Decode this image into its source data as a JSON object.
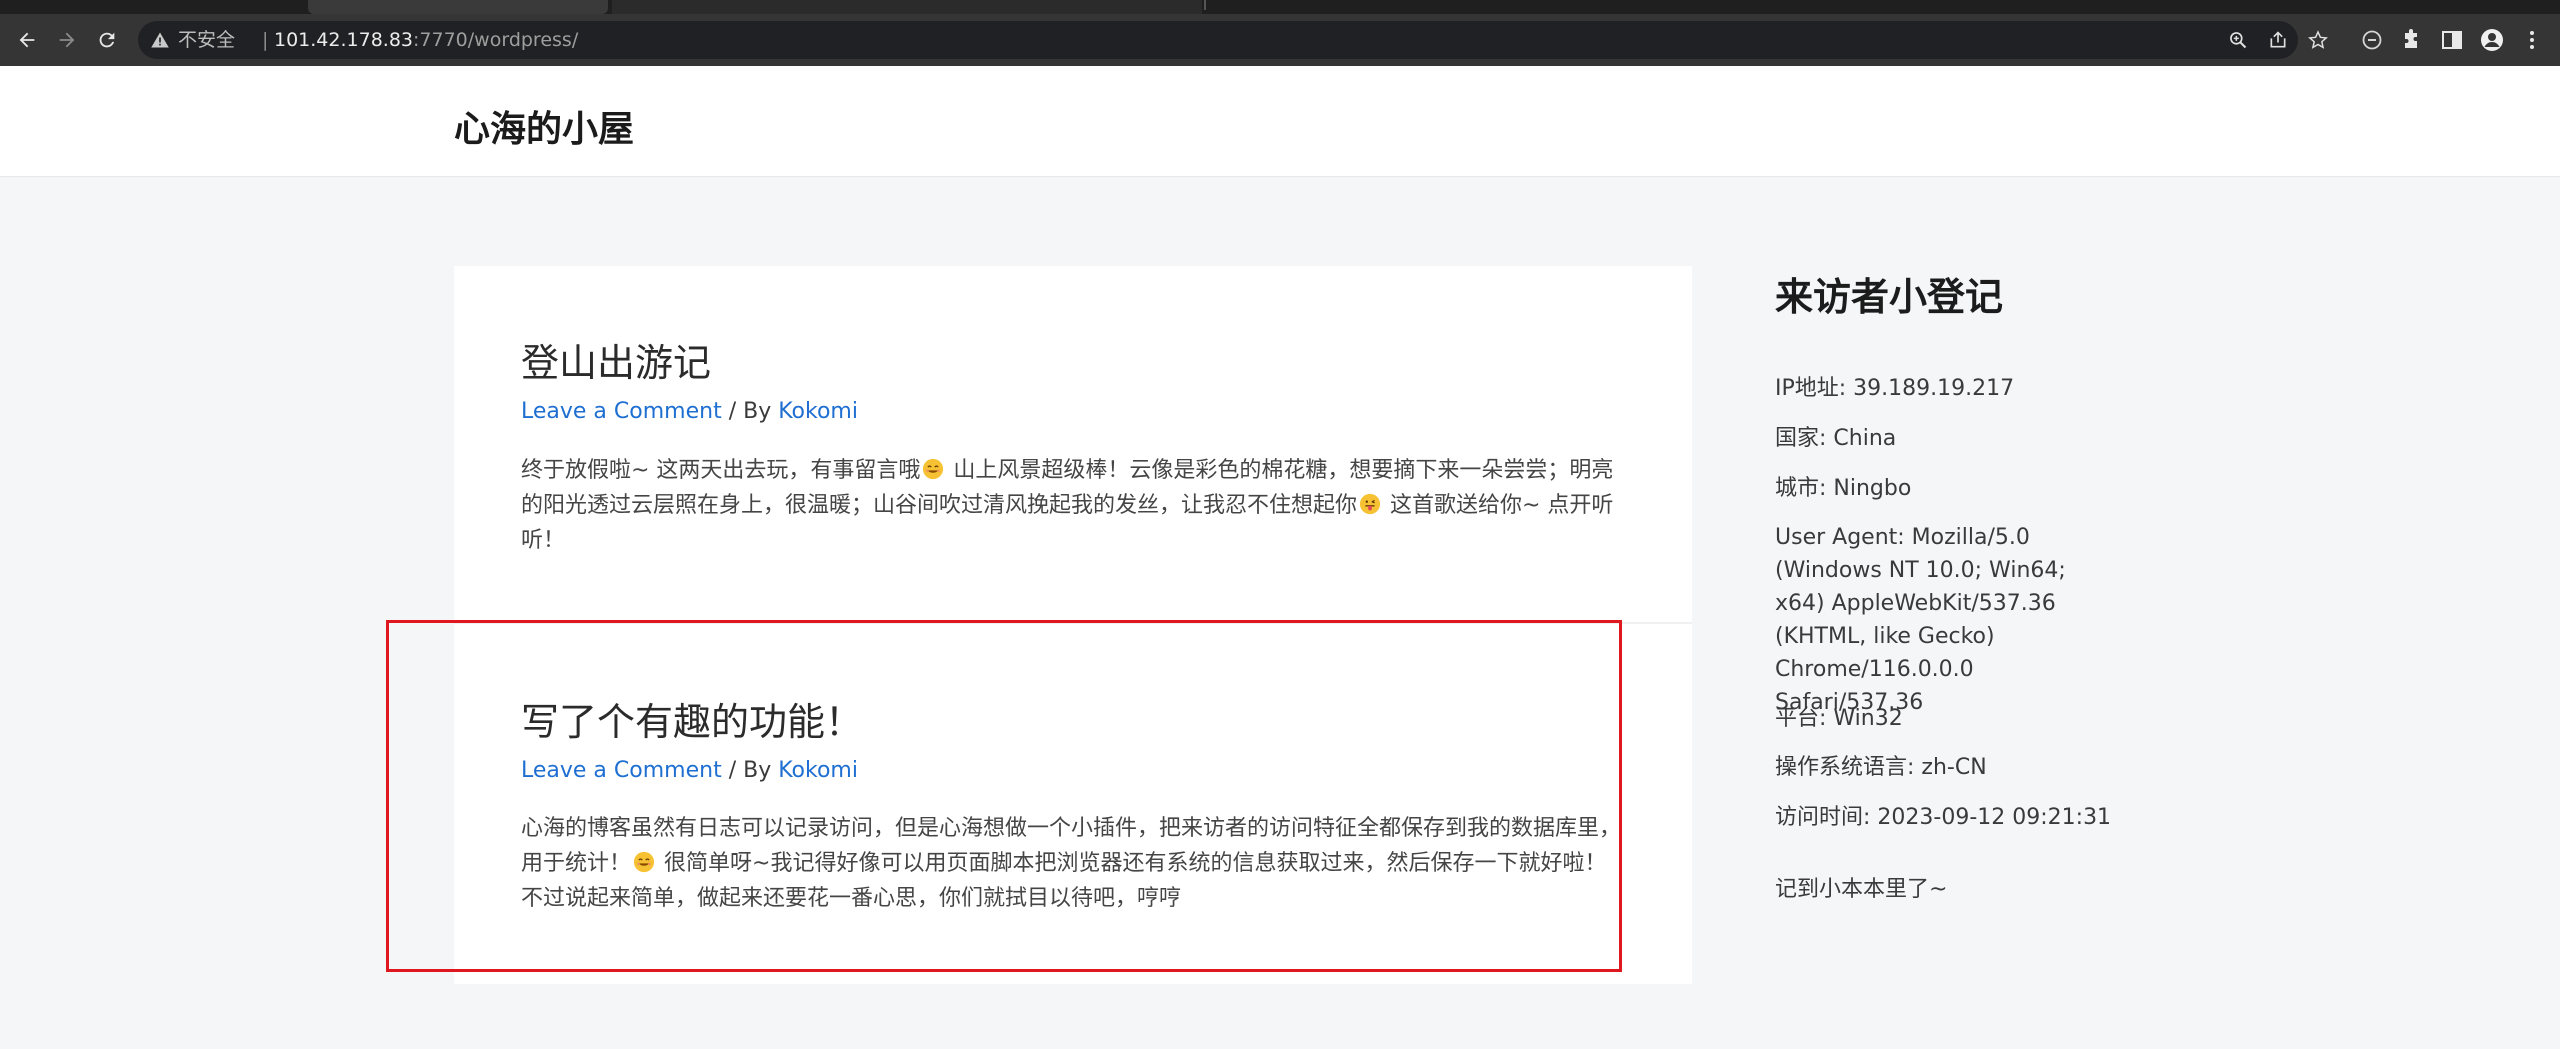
{
  "browser": {
    "security_label": "不安全",
    "url_host": "101.42.178.83",
    "url_rest": ":7770/wordpress/"
  },
  "site": {
    "title": "心海的小屋"
  },
  "posts": [
    {
      "title": "登山出游记",
      "comment_link": "Leave a Comment",
      "by_text": " / By ",
      "author": "Kokomi",
      "excerpt_part1": "终于放假啦~ 这两天出去玩，有事留言哦",
      "excerpt_part2": " 山上风景超级棒！云像是彩色的棉花糖，想要摘下来一朵尝尝；明亮的阳光透过云层照在身上，很温暖；山谷间吹过清风挽起我的发丝，让我忍不住想起你",
      "excerpt_part3": " 这首歌送给你~ 点开听听！"
    },
    {
      "title": "写了个有趣的功能！",
      "comment_link": "Leave a Comment",
      "by_text": " / By ",
      "author": "Kokomi",
      "excerpt_part1": "心海的博客虽然有日志可以记录访问，但是心海想做一个小插件，把来访者的访问特征全都保存到我的数据库里，用于统计！",
      "excerpt_part2": " 很简单呀~我记得好像可以用页面脚本把浏览器还有系统的信息获取过来，然后保存一下就好啦！不过说起来简单，做起来还要花一番心思，你们就拭目以待吧，哼哼"
    }
  ],
  "sidebar": {
    "title": "来访者小登记",
    "ip": "IP地址: 39.189.19.217",
    "country": "国家: China",
    "city": "城市: Ningbo",
    "user_agent": "User Agent: Mozilla/5.0 (Windows NT 10.0; Win64; x64) AppleWebKit/537.36 (KHTML, like Gecko) Chrome/116.0.0.0 Safari/537.36",
    "platform": "平台: Win32",
    "language": "操作系统语言: zh-CN",
    "visit_time": "访问时间: 2023-09-12 09:21:31",
    "footer_note": "记到小本本里了~"
  },
  "icons": {
    "back": "arrow-left-icon",
    "forward": "arrow-right-icon",
    "reload": "reload-icon",
    "warning": "warning-triangle-icon",
    "zoom": "zoom-icon",
    "share": "share-icon",
    "star": "star-icon",
    "minus": "minus-circle-icon",
    "extensions": "puzzle-icon",
    "sidepanel": "side-panel-icon",
    "profile": "profile-icon",
    "menu": "kebab-menu-icon",
    "emoji_smile": "smiling-emoji-icon",
    "emoji_tongue": "tongue-emoji-icon"
  },
  "colors": {
    "link": "#1e6fd1",
    "highlight": "#e0171f",
    "page_bg": "#f4f6f8"
  }
}
